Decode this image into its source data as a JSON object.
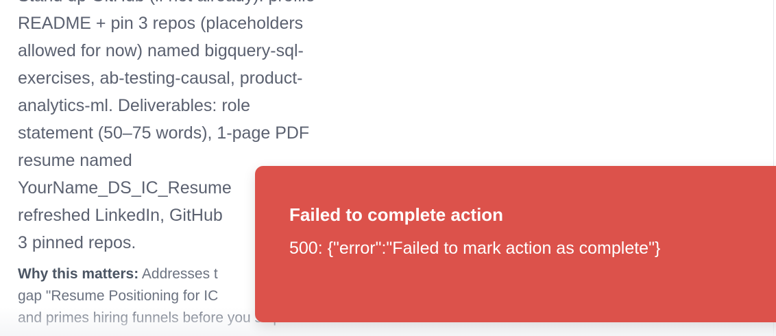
{
  "task": {
    "description_lines": [
      "Stand up GitHub (if not already): profile",
      "README + pin 3 repos (placeholders",
      "allowed for now) named bigquery-sql-",
      "exercises, ab-testing-causal, product-",
      "analytics-ml. Deliverables: role",
      "statement (50–75 words), 1-page PDF",
      "resume named",
      "YourName_DS_IC_Resume",
      "refreshed LinkedIn, GitHub",
      "3 pinned repos."
    ],
    "why_label": "Why this matters:",
    "why_lines": [
      " Addresses t",
      "gap \"Resume Positioning for IC",
      "and primes hiring funnels before you ship"
    ]
  },
  "toast": {
    "title": "Failed to complete action",
    "message": "500: {\"error\":\"Failed to mark action as complete\"}"
  },
  "colors": {
    "toast_background": "#dc524b",
    "body_text": "#5b6170"
  }
}
